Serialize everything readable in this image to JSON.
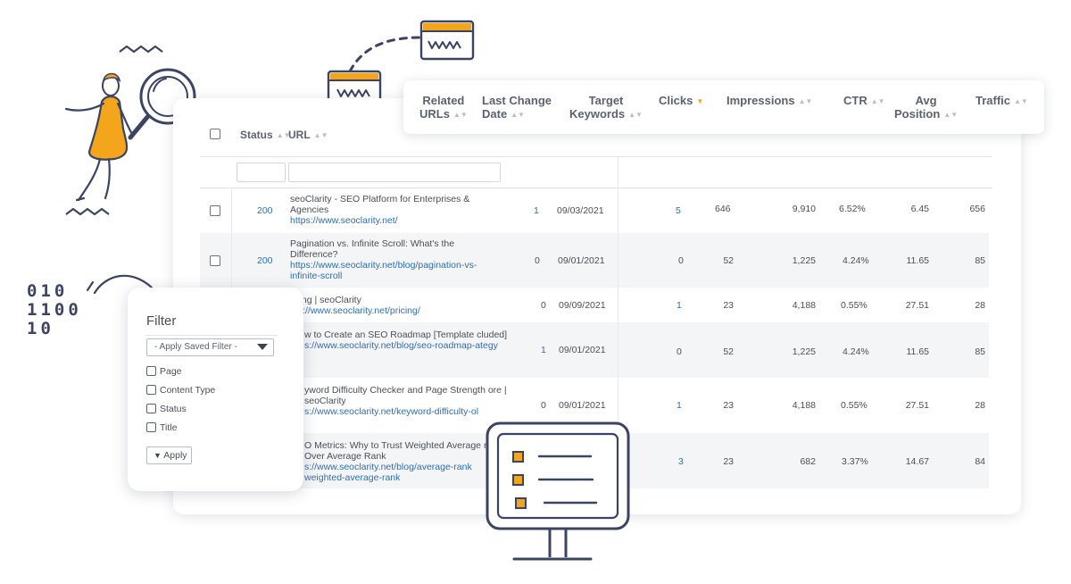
{
  "colors": {
    "accent": "#f3a51b",
    "link": "#2d6fb7",
    "ink": "#3c4463",
    "row_alt": "#f4f5f7"
  },
  "header_columns": {
    "related_urls": [
      "Related",
      "URLs"
    ],
    "last_change_date": [
      "Last Change",
      "Date"
    ],
    "target_keywords": [
      "Target",
      "Keywords"
    ],
    "clicks": "Clicks",
    "impressions": "Impressions",
    "ctr": "CTR",
    "avg_position": [
      "Avg",
      "Position"
    ],
    "traffic": "Traffic",
    "sorted_column": "clicks"
  },
  "table": {
    "status_header": "Status",
    "url_header": "URL",
    "rows": [
      {
        "status": "200",
        "title": "seoClarity - SEO Platform for Enterprises & Agencies",
        "url": "https://www.seoclarity.net/",
        "related": "1",
        "date": "09/03/2021",
        "keywords": "",
        "clicks": "5",
        "impressions": "646",
        "ctr_base": "9,910",
        "ctr": "6.52%",
        "avg_position": "6.45",
        "traffic": "656",
        "checkbox": true
      },
      {
        "status": "200",
        "title": "Pagination vs. Infinite Scroll: What's the Difference?",
        "url": "https://www.seoclarity.net/blog/pagination-vs-infinite-scroll",
        "related": "0",
        "date": "09/01/2021",
        "keywords": "",
        "clicks": "0",
        "impressions": "52",
        "ctr_base": "1,225",
        "ctr": "4.24%",
        "avg_position": "11.65",
        "traffic": "85",
        "checkbox": true
      },
      {
        "status": "",
        "title": "icing | seoClarity",
        "url": "ps://www.seoclarity.net/pricing/",
        "related": "0",
        "date": "09/09/2021",
        "keywords": "",
        "clicks": "1",
        "impressions": "23",
        "ctr_base": "4,188",
        "ctr": "0.55%",
        "avg_position": "27.51",
        "traffic": "28",
        "checkbox": false
      },
      {
        "status": "",
        "title": "w to Create an SEO Roadmap [Template cluded]",
        "url": "s://www.seoclarity.net/blog/seo-roadmap-ategy",
        "related": "1",
        "date": "09/01/2021",
        "keywords": "",
        "clicks": "0",
        "impressions": "52",
        "ctr_base": "1,225",
        "ctr": "4.24%",
        "avg_position": "11.65",
        "traffic": "85",
        "checkbox": false
      },
      {
        "status": "",
        "title": "yword Difficulty Checker and Page Strength ore | seoClarity",
        "url": "s://www.seoclarity.net/keyword-difficulty-ol",
        "related": "0",
        "date": "09/01/2021",
        "keywords": "",
        "clicks": "1",
        "impressions": "23",
        "ctr_base": "4,188",
        "ctr": "0.55%",
        "avg_position": "27.51",
        "traffic": "28",
        "checkbox": false
      },
      {
        "status": "",
        "title": "O Metrics: Why to Trust Weighted Average nk Over Average Rank",
        "url": "s://www.seoclarity.net/blog/average-rank weighted-average-rank",
        "related": "",
        "date": "",
        "keywords": "",
        "clicks": "3",
        "impressions": "23",
        "ctr_base": "682",
        "ctr": "3.37%",
        "avg_position": "14.67",
        "traffic": "84",
        "checkbox": false
      }
    ]
  },
  "filter_panel": {
    "title": "Filter",
    "saved_filter_placeholder": "- Apply Saved Filter -",
    "options": [
      "Page",
      "Content Type",
      "Status",
      "Title"
    ],
    "apply_label": "Apply"
  },
  "decor": {
    "binary_lines": [
      "010",
      "1100",
      "10"
    ],
    "browser_icon_text": "www"
  }
}
